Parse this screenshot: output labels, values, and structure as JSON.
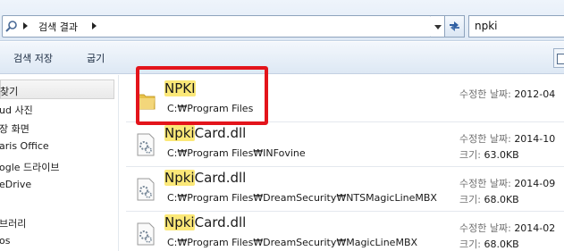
{
  "address_bar": {
    "breadcrumb": "검색 결과"
  },
  "search": {
    "query": "npki"
  },
  "toolbar": {
    "save_search_label": "검색 저장",
    "burn_label": "굽기"
  },
  "nav": {
    "items": [
      {
        "label": "찾기",
        "selected": true
      },
      {
        "label": "ud 사진",
        "selected": false
      },
      {
        "label": "장 화면",
        "selected": false
      },
      {
        "label": "aris Office",
        "selected": false
      },
      {
        "label": "ogle 드라이브",
        "selected": false
      },
      {
        "label": "eDrive",
        "selected": false
      },
      {
        "label": "",
        "selected": false
      },
      {
        "label": "브러리",
        "selected": false
      },
      {
        "label": "os",
        "selected": false
      }
    ]
  },
  "results": [
    {
      "type": "folder",
      "name_highlight": "NPKI",
      "name_rest": "",
      "path": "C:₩Program Files",
      "meta1_label": "수정한 날짜:",
      "meta1_value": "2012-04",
      "meta2_label": "",
      "meta2_value": ""
    },
    {
      "type": "dll",
      "name_highlight": "Npki",
      "name_rest": "Card.dll",
      "path": "C:₩Program Files₩INFovine",
      "meta1_label": "수정한 날짜:",
      "meta1_value": "2014-10",
      "meta2_label": "크기:",
      "meta2_value": "63.0KB"
    },
    {
      "type": "dll",
      "name_highlight": "Npki",
      "name_rest": "Card.dll",
      "path": "C:₩Program Files₩DreamSecurity₩NTSMagicLineMBX",
      "meta1_label": "수정한 날짜:",
      "meta1_value": "2014-09",
      "meta2_label": "크기:",
      "meta2_value": "68.0KB"
    },
    {
      "type": "dll",
      "name_highlight": "Npki",
      "name_rest": "Card.dll",
      "path": "C:₩Program Files₩DreamSecurity₩MagicLineMBX",
      "meta1_label": "수정한 날짜:",
      "meta1_value": "2014-02",
      "meta2_label": "크기:",
      "meta2_value": "68.0KB"
    }
  ],
  "colors": {
    "highlight": "#fbe878",
    "annotation": "#e3141b",
    "folder": "#e8c24a"
  },
  "icons": {
    "address": "search-folder-icon",
    "refresh": "refresh-icon",
    "folder": "folder-icon",
    "dll": "dll-file-icon"
  }
}
